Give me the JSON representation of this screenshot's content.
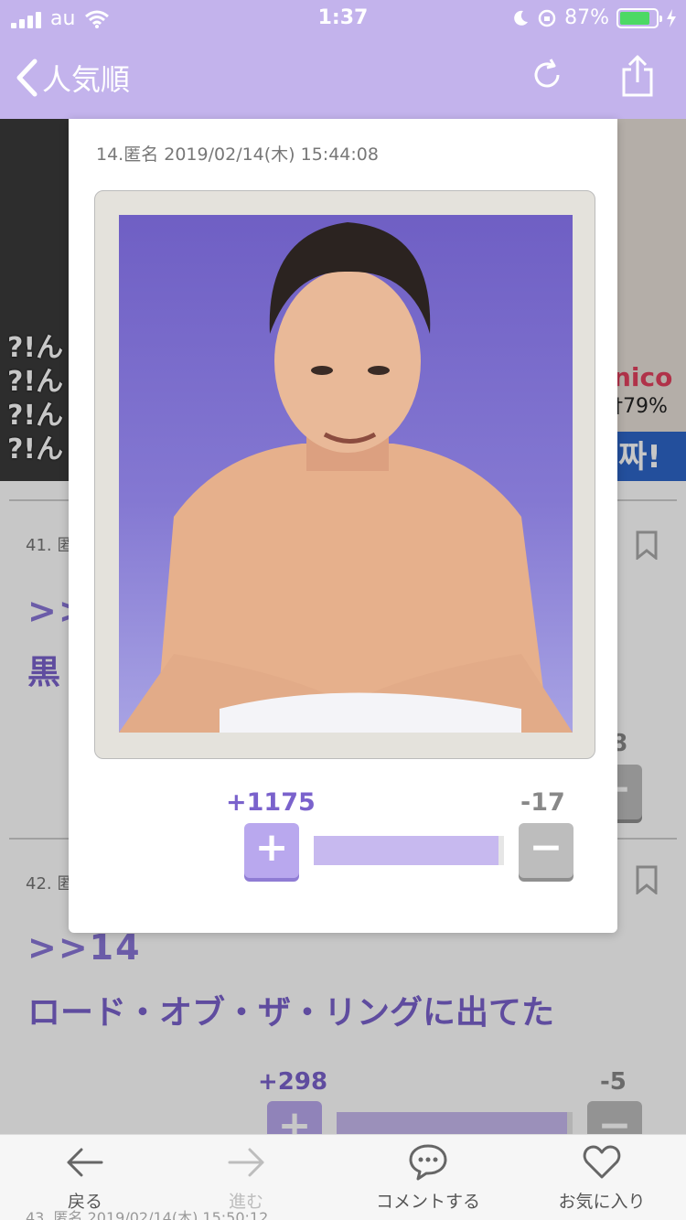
{
  "status_bar": {
    "carrier": "au",
    "time": "1:37",
    "battery": "87%"
  },
  "nav": {
    "back_label": "人気順",
    "reload_icon": "reload-icon",
    "share_icon": "share-icon"
  },
  "banner": {
    "left_text": "?!ん\n?!ん\n?!ん\n?!ん",
    "right_ad_brand": "nico",
    "right_ad_discount": "†79%",
    "right_ad_cta": "짜!"
  },
  "posts": [
    {
      "meta": "41. 匿",
      "anchor": ">>",
      "body": "黒",
      "minus_count": "8"
    },
    {
      "meta": "42. 匿",
      "anchor": ">>14",
      "body": "ロード・オブ・ザ・リングに出てた",
      "plus_count": "+298",
      "minus_count": "-5"
    }
  ],
  "modal": {
    "meta": "14.匿名 2019/02/14(木) 15:44:08",
    "plus_count": "+1175",
    "minus_count": "-17",
    "plus_symbol": "+",
    "minus_symbol": "−",
    "vote_ratio": 0.986
  },
  "bottom_partial": "43. 匿名 2019/02/14(木) 15:50:12",
  "toolbar": {
    "back": "戻る",
    "forward": "進む",
    "comment": "コメントする",
    "favorite": "お気に入り"
  },
  "colors": {
    "accent": "#c3b3ec",
    "accent_text": "#7a62cc",
    "battery_green": "#4cd964"
  }
}
